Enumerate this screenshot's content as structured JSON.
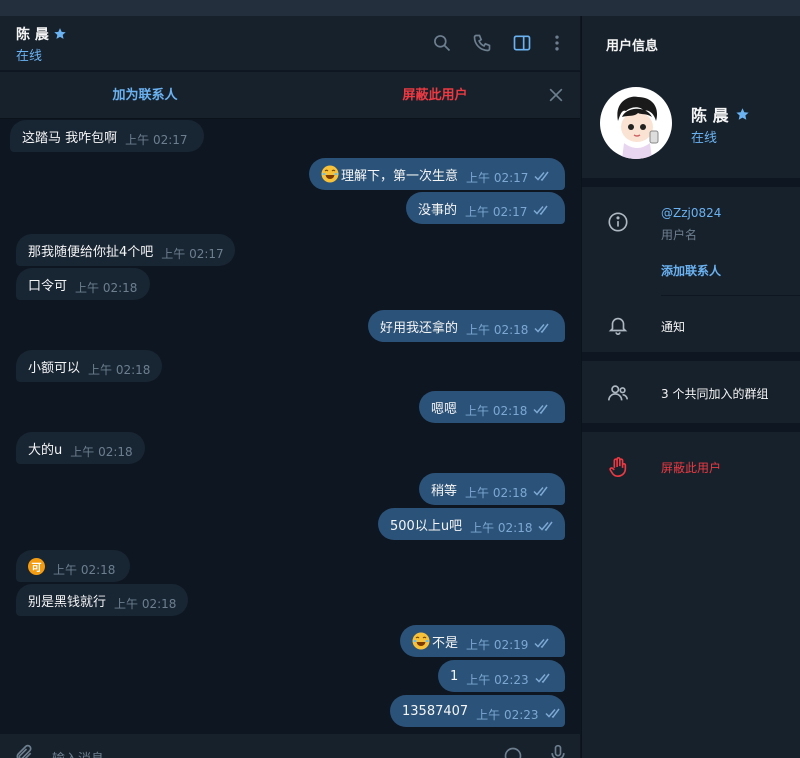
{
  "chat": {
    "peer_name": "陈 晨",
    "peer_status": "在线",
    "action_add_contact": "加为联系人",
    "action_block_user": "屏蔽此用户",
    "composer_placeholder": "输入消息"
  },
  "messages": [
    {
      "dir": "in",
      "text": "这踏马 我咋包啊",
      "time": "上午 02:17"
    },
    {
      "dir": "out",
      "text": "理解下，第一次生意",
      "time": "上午 02:17",
      "emoji": "laugh"
    },
    {
      "dir": "out",
      "text": "没事的",
      "time": "上午 02:17"
    },
    {
      "dir": "in",
      "text": "那我随便给你扯4个吧",
      "time": "上午 02:17"
    },
    {
      "dir": "in",
      "text": "口令可",
      "time": "上午 02:18"
    },
    {
      "dir": "out",
      "text": "好用我还拿的",
      "time": "上午 02:18"
    },
    {
      "dir": "in",
      "text": "小额可以",
      "time": "上午 02:18"
    },
    {
      "dir": "out",
      "text": "嗯嗯",
      "time": "上午 02:18"
    },
    {
      "dir": "in",
      "text": "大的u",
      "time": "上午 02:18"
    },
    {
      "dir": "out",
      "text": "稍等",
      "time": "上午 02:18"
    },
    {
      "dir": "out",
      "text": "500以上u吧",
      "time": "上午 02:18"
    },
    {
      "dir": "in",
      "text": "",
      "time": "上午 02:18",
      "emoji": "ke"
    },
    {
      "dir": "in",
      "text": "别是黑钱就行",
      "time": "上午 02:18"
    },
    {
      "dir": "out",
      "text": "不是",
      "time": "上午 02:19",
      "emoji": "laugh"
    },
    {
      "dir": "out",
      "text": "1",
      "time": "上午 02:23"
    },
    {
      "dir": "out",
      "text": "13587407",
      "time": "上午 02:23"
    }
  ],
  "info": {
    "title": "用户信息",
    "name": "陈 晨",
    "status": "在线",
    "username": "@Zzj0824",
    "username_label": "用户名",
    "add_contact": "添加联系人",
    "notifications": "通知",
    "groups_in_common": "3 个共同加入的群组",
    "block_user": "屏蔽此用户"
  },
  "emoji_text": {
    "ke": "可"
  },
  "colors": {
    "accent": "#6ab2f2",
    "danger": "#ec3942",
    "bubble_out": "#2b5278",
    "bubble_in": "#182533",
    "background": "#0e1621",
    "panel": "#17212b"
  }
}
